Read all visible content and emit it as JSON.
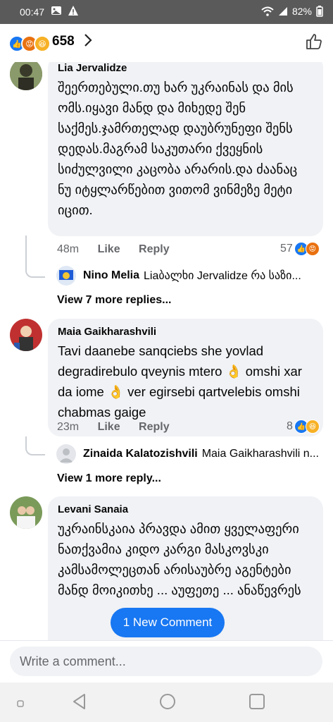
{
  "status": {
    "time": "00:47",
    "battery": "82%"
  },
  "header": {
    "reaction_count": "658"
  },
  "comments": [
    {
      "author": "Lia Jervalidze",
      "text": "შეერთებული.თუ ხარ უკრაინას და მის ომს.იყავი მანდ და მიხედე შენ საქმეს.ჯამრთელად დაუბრუნეფი შენს დედას.მაგრამ საკუთარი ქვეყნის სიძულვილი კაცობა არარის.და ძაანაც ნუ იტყლარწებით ვითომ ვინმეზე მეტი იცით.",
      "time": "48m",
      "like": "Like",
      "reply": "Reply",
      "reactions": "57",
      "reply_preview": {
        "author": "Nino Melia",
        "text": "Liaბალხი Jervalidze რა საზი..."
      },
      "more": "View 7 more replies..."
    },
    {
      "author": "Maia Gaikharashvili",
      "text": "Tavi daanebe sanqciebs she yovlad degradirebulo qveynis mtero 👌 omshi xar da iome 👌 ver egirsebi qartvelebis omshi chabmas gaige",
      "time": "23m",
      "like": "Like",
      "reply": "Reply",
      "reactions": "8",
      "reply_preview": {
        "author": "Zinaida Kalatozishvili",
        "text": "Maia Gaikharashvili n..."
      },
      "more": "View 1 more reply..."
    },
    {
      "author": "Levani Sanaia",
      "text": "უკრაინსკაია პრავდა ამით ყველაფერი ნათქვამია კიდო კარგი მასკოვსკი კამსამოლეცთან არისაუბრე აგენტები მანდ მოიკითხე ... აუფეთე ... ანაწევრეს"
    }
  ],
  "new_comment": "1 New Comment",
  "write_placeholder": "Write a comment..."
}
